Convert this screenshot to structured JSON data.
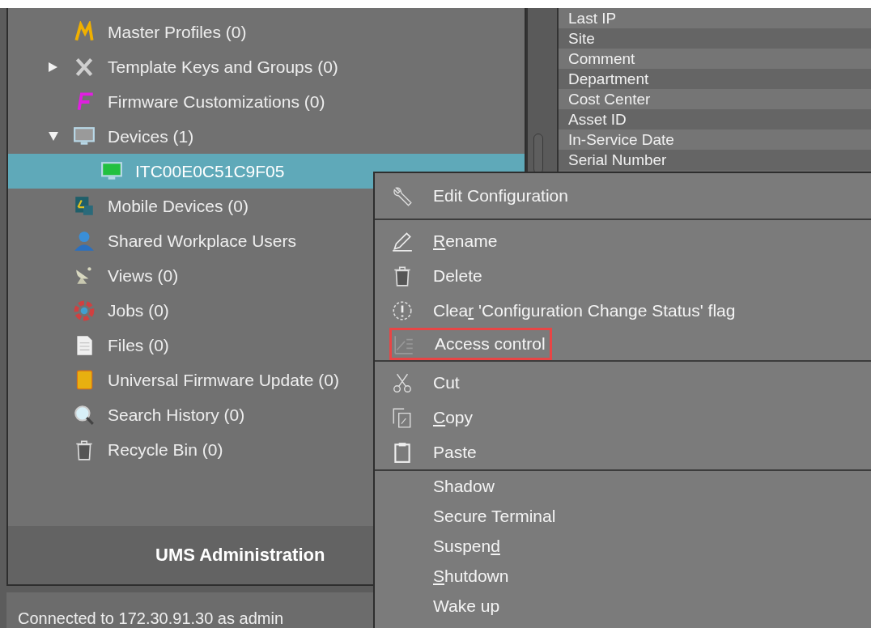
{
  "tree": [
    {
      "label": "Master Profiles (0)",
      "selected": false
    },
    {
      "label": "Template Keys and Groups (0)",
      "selected": false,
      "expanded": false
    },
    {
      "label": "Firmware Customizations (0)",
      "selected": false
    },
    {
      "label": "Devices (1)",
      "selected": false,
      "expanded": true,
      "children": [
        {
          "label": "ITC00E0C51C9F05",
          "selected": true
        }
      ]
    },
    {
      "label": "Mobile Devices (0)",
      "selected": false
    },
    {
      "label": "Shared Workplace Users",
      "selected": false
    },
    {
      "label": "Views (0)",
      "selected": false
    },
    {
      "label": "Jobs (0)",
      "selected": false
    },
    {
      "label": "Files (0)",
      "selected": false
    },
    {
      "label": "Universal Firmware Update (0)",
      "selected": false
    },
    {
      "label": "Search History (0)",
      "selected": false
    },
    {
      "label": "Recycle Bin (0)",
      "selected": false
    }
  ],
  "panel_title": "UMS Administration",
  "status_bar": "Connected to 172.30.91.30 as admin",
  "properties": [
    "Last IP",
    "Site",
    "Comment",
    "Department",
    "Cost Center",
    "Asset ID",
    "In-Service Date",
    "Serial Number"
  ],
  "context_menu": [
    [
      {
        "kind": "icon",
        "before": "Edit Confi",
        "key": "g",
        "after": "uration",
        "marked": false
      }
    ],
    [
      {
        "kind": "icon",
        "key": "R",
        "after": "ename",
        "marked": false
      },
      {
        "kind": "icon",
        "before": "Delete",
        "marked": false
      },
      {
        "kind": "icon",
        "before": "Clea",
        "key": "r",
        "after": " 'Configuration Change Status' flag",
        "marked": false
      },
      {
        "kind": "icon",
        "before": "Access control",
        "marked": true
      }
    ],
    [
      {
        "kind": "icon",
        "before": "Cut",
        "marked": false
      },
      {
        "kind": "icon",
        "key": "C",
        "after": "opy",
        "marked": false
      },
      {
        "kind": "icon",
        "before": "Paste",
        "marked": false
      }
    ],
    [
      {
        "kind": "plain",
        "before": "Shadow",
        "marked": false
      },
      {
        "kind": "plain",
        "before": "Secure Terminal",
        "marked": false
      },
      {
        "kind": "plain",
        "before": "Suspen",
        "key": "d",
        "marked": false
      },
      {
        "kind": "plain",
        "key": "S",
        "after": "hutdown",
        "marked": false
      },
      {
        "kind": "plain",
        "before": "Wake up",
        "marked": false
      }
    ]
  ]
}
